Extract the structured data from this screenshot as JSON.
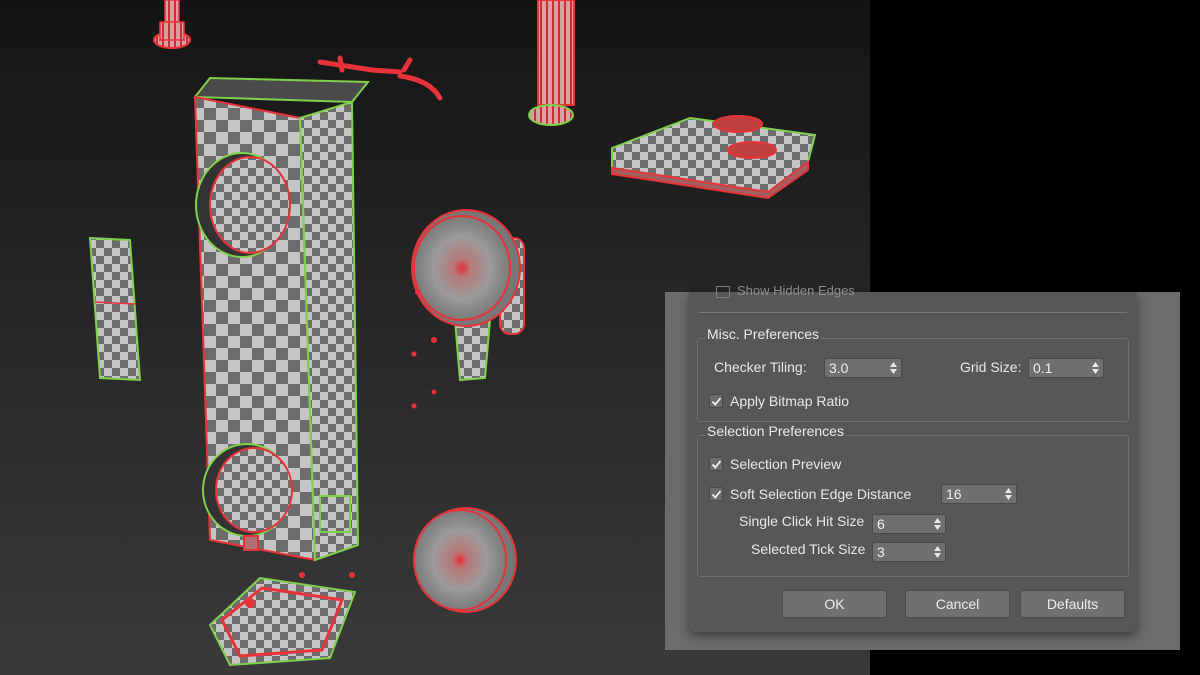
{
  "dialog": {
    "ghost_row_label": "Show Hidden Edges",
    "misc": {
      "title": "Misc. Preferences",
      "checker_tiling_label": "Checker Tiling:",
      "checker_tiling_value": "3.0",
      "grid_size_label": "Grid Size:",
      "grid_size_value": "0.1",
      "apply_bitmap_ratio_label": "Apply Bitmap Ratio",
      "apply_bitmap_ratio_checked": true
    },
    "selection": {
      "title": "Selection Preferences",
      "selection_preview_label": "Selection Preview",
      "selection_preview_checked": true,
      "soft_selection_label": "Soft Selection Edge Distance",
      "soft_selection_checked": true,
      "soft_selection_value": "16",
      "single_click_label": "Single Click Hit Size",
      "single_click_value": "6",
      "selected_tick_label": "Selected Tick Size",
      "selected_tick_value": "3"
    },
    "buttons": {
      "ok": "OK",
      "cancel": "Cancel",
      "defaults": "Defaults"
    }
  },
  "colors": {
    "seam_red": "#e8323a",
    "seam_green": "#7fd04a",
    "checker_light": "#bdbdbd",
    "checker_dark": "#6e6e6e"
  }
}
